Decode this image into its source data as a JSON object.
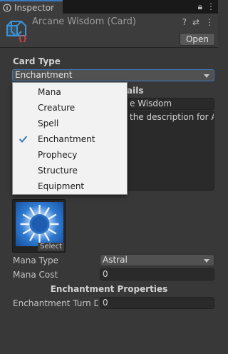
{
  "tab": {
    "label": "Inspector",
    "lock_icon": "lock-icon",
    "menu_icon": "kebab-menu-icon"
  },
  "header": {
    "title": "Arcane Wisdom (Card)",
    "open_label": "Open",
    "icons": [
      "help-icon",
      "settings-icon",
      "more-icon"
    ]
  },
  "card_type": {
    "label": "Card Type",
    "selected": "Enchantment",
    "options": [
      "Mana",
      "Creature",
      "Spell",
      "Enchantment",
      "Prophecy",
      "Structure",
      "Equipment"
    ],
    "checked_index": 3
  },
  "card_details": {
    "partial_heading": "ails",
    "name_value": "e Wisdom",
    "description_value": "the description for Arc"
  },
  "sprite": {
    "select_label": "Select"
  },
  "fields": {
    "mana_type_label": "Mana Type",
    "mana_type_value": "Astral",
    "mana_cost_label": "Mana Cost",
    "mana_cost_value": "0"
  },
  "enchantment": {
    "heading": "Enchantment Properties",
    "turn_label": "Enchantment Turn Du",
    "turn_value": "0"
  },
  "colors": {
    "accent": "#3a79bb",
    "checkmark": "#3a79bb"
  }
}
